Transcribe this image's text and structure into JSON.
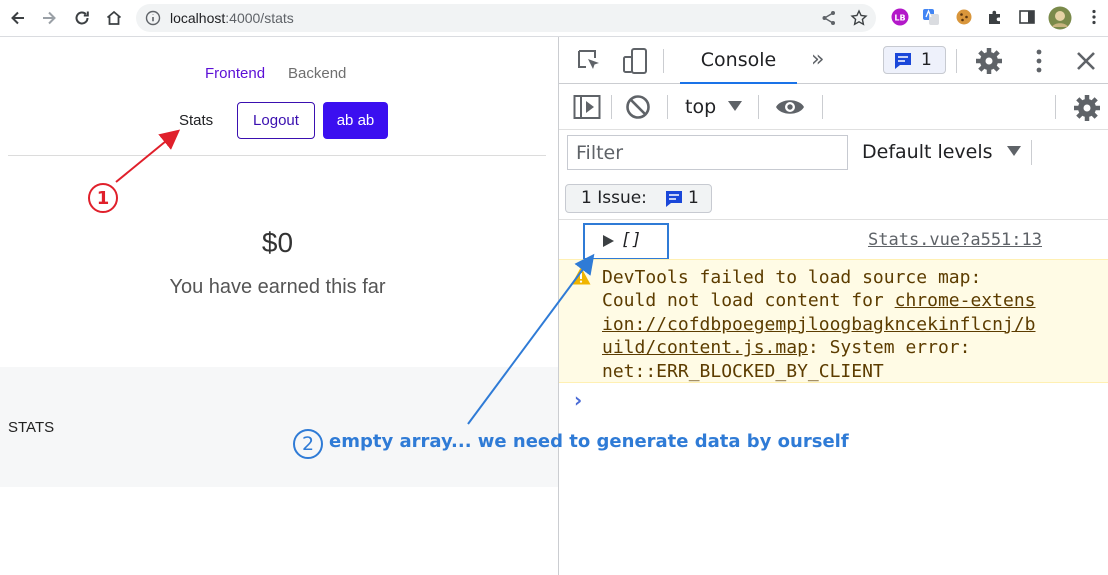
{
  "browser": {
    "url_host": "localhost",
    "url_path": ":4000/stats",
    "profile_badge": "LB"
  },
  "page": {
    "nav": {
      "frontend": "Frontend",
      "backend": "Backend"
    },
    "stats_link": "Stats",
    "logout_button": "Logout",
    "user_button": "ab ab",
    "amount": "$0",
    "earned_text": "You have earned this far",
    "stats_heading": "STATS"
  },
  "devtools": {
    "tab_console": "Console",
    "tab_more": "»",
    "messages_count": "1",
    "context": "top",
    "filter_placeholder": "Filter",
    "levels": "Default levels",
    "issues_label": "1 Issue:",
    "issues_count": "1",
    "log_value": "[]",
    "log_source": "Stats.vue?a551:13",
    "warning": {
      "line1": "DevTools failed to load source map:",
      "line2_prefix": "Could not load content for ",
      "link_part1": "chrome-extens",
      "link_part2": "ion://cofdbpoegempjloogbagkncekinflcnj/b",
      "link_part3": "uild/content.js.map",
      "line4_suffix": ": System error:",
      "line5": "net::ERR_BLOCKED_BY_CLIENT"
    },
    "prompt": "›"
  },
  "annotations": {
    "num1": "1",
    "num2": "2",
    "note2": "empty array... we need to generate data by ourself",
    "color_red": "#e0202b",
    "color_blue": "#2f7bd6"
  },
  "colors": {
    "accent_purple": "#3b0ff0",
    "frontend_link": "#5b0fd6",
    "devtools_blue": "#1a73e8",
    "warning_bg": "#fffbe5"
  }
}
